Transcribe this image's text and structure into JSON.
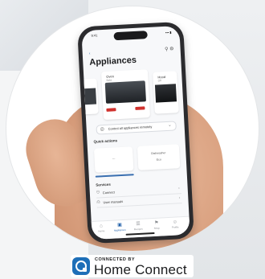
{
  "badge": {
    "connected_by": "CONNECTED BY",
    "brand": "Home Connect",
    "brand_color": "#1e6fb8"
  },
  "phone": {
    "status": {
      "time": "9:41",
      "icons": "▪▪▪ ▮"
    },
    "header": {
      "back": "‹",
      "icons": "⚲ ⚙"
    },
    "title": "Appliances",
    "cards": [
      {
        "label": "Oven",
        "sub": "Bake"
      },
      {
        "label": "Hood",
        "sub": "Off"
      },
      {
        "label": "",
        "sub": ""
      }
    ],
    "dropdown": "Control all appliances remotely",
    "section_actions": "Quick actions",
    "tile_texts": [
      "—",
      "Dishwasher",
      "Eco"
    ],
    "section_services": "Services",
    "list": [
      {
        "icon": "⚇",
        "text": "Connect"
      },
      {
        "icon": "⎙",
        "text": "User manuals"
      }
    ],
    "tabs": [
      {
        "icon": "⌂",
        "label": "Home"
      },
      {
        "icon": "▣",
        "label": "Appliances"
      },
      {
        "icon": "☰",
        "label": "Recipes"
      },
      {
        "icon": "⚑",
        "label": "Shop"
      },
      {
        "icon": "☺",
        "label": "Profile"
      }
    ],
    "accent": "#1f5fa8"
  }
}
